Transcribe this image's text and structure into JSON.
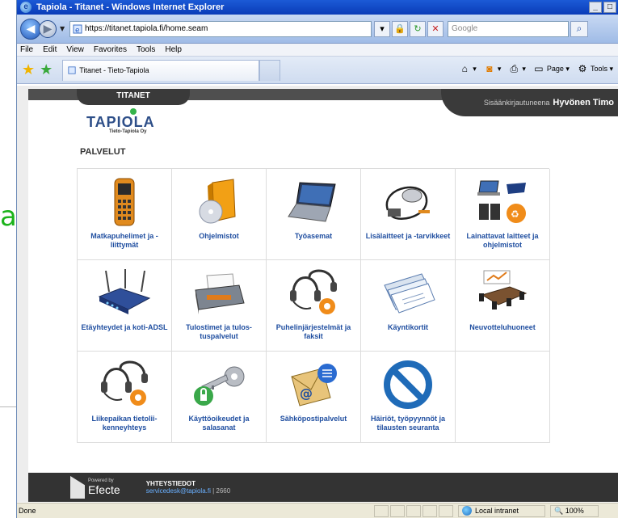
{
  "window": {
    "title": "Tapiola - Titanet   - Windows Internet Explorer",
    "buttons": [
      "_",
      "□",
      "X"
    ]
  },
  "address_bar": {
    "url": "https://titanet.tapiola.fi/home.seam",
    "search_placeholder": "Google"
  },
  "menu": [
    "File",
    "Edit",
    "View",
    "Favorites",
    "Tools",
    "Help"
  ],
  "tab": {
    "title": "Titanet - Tieto-Tapiola"
  },
  "command_bar": {
    "page_label": "Page",
    "tools_label": "Tools"
  },
  "portal": {
    "brand_tab": "TITANET",
    "logged_in_prefix": "Sisäänkirjautuneena",
    "user_name": "Hyvönen Timo",
    "logo_word": "TAPIOLA",
    "logo_sub": "Tieto-Tapiola Oy",
    "section_title": "PALVELUT",
    "services": [
      {
        "label": "Matkapuhelimet ja -liittymät",
        "icon": "mobile-phone-icon"
      },
      {
        "label": "Ohjelmistot",
        "icon": "software-box-icon"
      },
      {
        "label": "Työasemat",
        "icon": "laptop-icon"
      },
      {
        "label": "Lisälaitteet ja -tarvikkeet",
        "icon": "mouse-cable-icon"
      },
      {
        "label": "Lainattavat laitteet ja ohjelmistot",
        "icon": "loan-devices-icon"
      },
      {
        "label": "Etäyhteydet ja koti-ADSL",
        "icon": "router-icon"
      },
      {
        "label": "Tulostimet ja tulos-tuspalvelut",
        "icon": "printer-icon"
      },
      {
        "label": "Puhelinjärjestelmät ja faksit",
        "icon": "headset-icon"
      },
      {
        "label": "Käyntikortit",
        "icon": "business-cards-icon"
      },
      {
        "label": "Neuvotteluhuoneet",
        "icon": "meeting-room-icon"
      },
      {
        "label": "Liikepaikan tietolii-kenneyhteys",
        "icon": "headset-icon"
      },
      {
        "label": "Käyttöoikeudet ja salasanat",
        "icon": "key-lock-icon"
      },
      {
        "label": "Sähköpostipalvelut",
        "icon": "email-icon"
      },
      {
        "label": "Häiriöt, työpyynnöt ja tilausten seuranta",
        "icon": "no-sign-icon"
      }
    ]
  },
  "footer": {
    "powered_by": "Powered by",
    "brand": "Efecte",
    "contact_heading": "YHTEYSTIEDOT",
    "contact_email": "servicedesk@tapiola.fi",
    "contact_phone": "| 2660"
  },
  "status": {
    "left": "Done",
    "zone": "Local intranet",
    "zoom": "100%"
  },
  "backdrop": {
    "char": "a"
  },
  "colors": {
    "title_bar": "#0a3cb8",
    "link_blue": "#1f4ea0",
    "footer_bg": "#333333",
    "logo_green": "#35b44a"
  }
}
